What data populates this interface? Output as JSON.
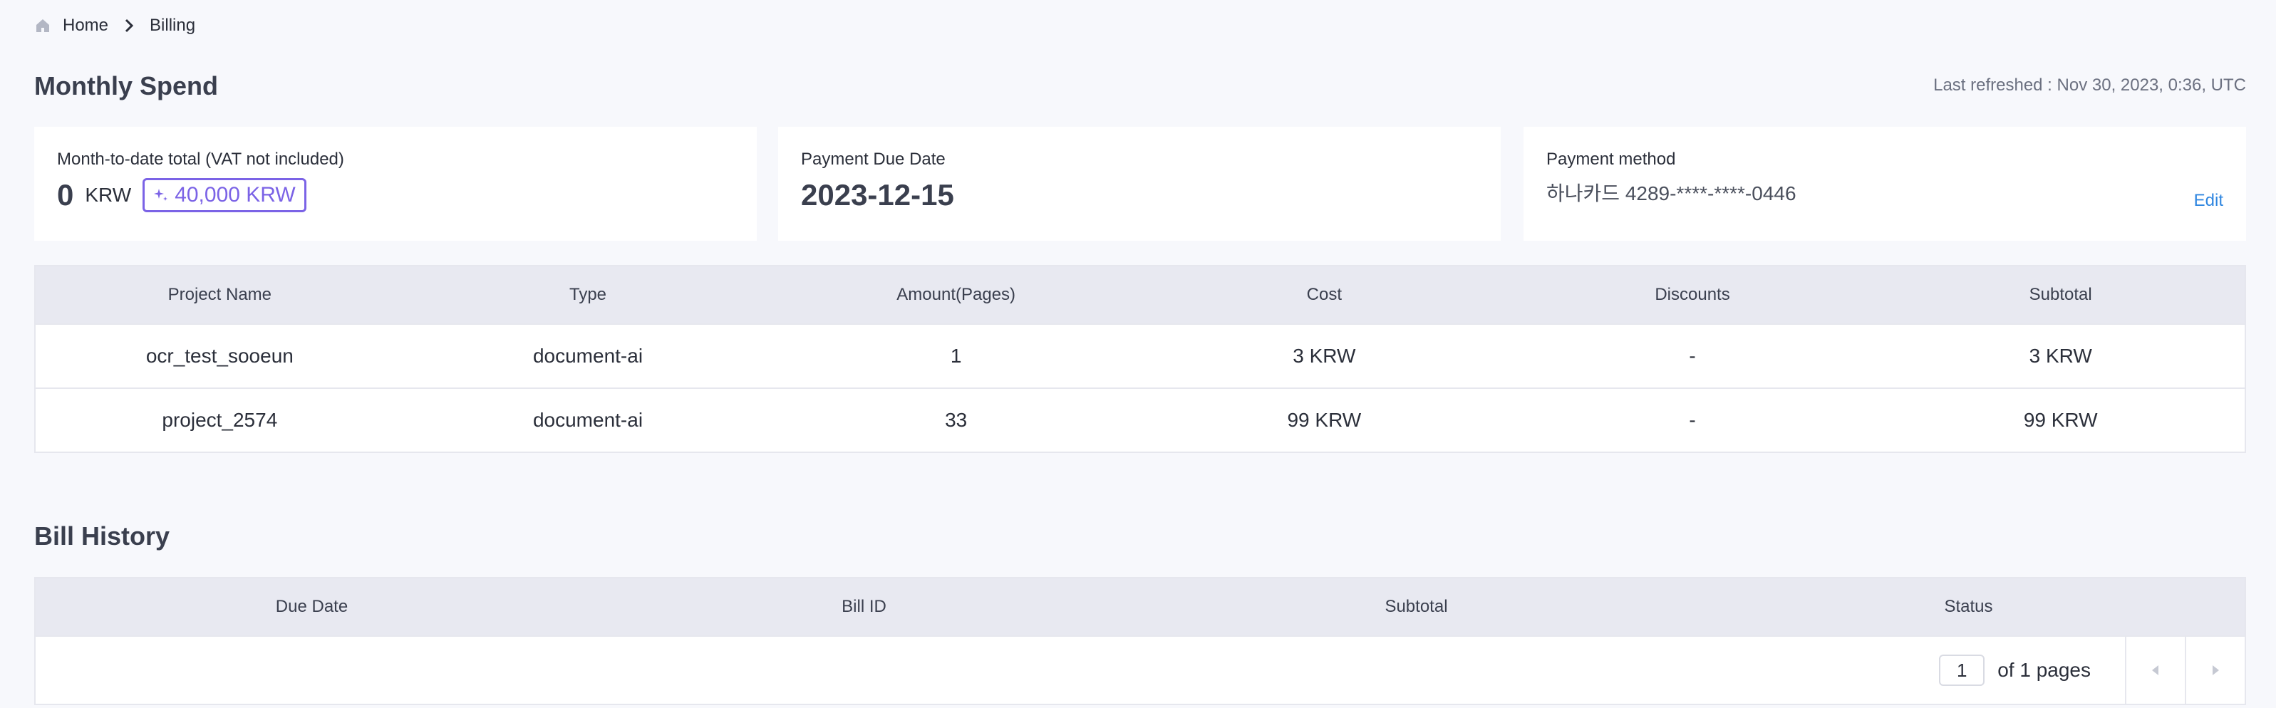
{
  "breadcrumb": {
    "home_label": "Home",
    "current_label": "Billing"
  },
  "monthly_spend": {
    "title": "Monthly Spend",
    "last_refreshed": "Last refreshed : Nov 30, 2023, 0:36, UTC"
  },
  "cards": {
    "mtd": {
      "label": "Month-to-date total (VAT not included)",
      "amount": "0",
      "unit": "KRW",
      "credit": "40,000 KRW"
    },
    "due": {
      "label": "Payment Due Date",
      "date": "2023-12-15"
    },
    "payment": {
      "label": "Payment method",
      "card": "하나카드 4289-****-****-0446",
      "edit_label": "Edit"
    }
  },
  "usage_table": {
    "headers": [
      "Project Name",
      "Type",
      "Amount(Pages)",
      "Cost",
      "Discounts",
      "Subtotal"
    ],
    "rows": [
      [
        "ocr_test_sooeun",
        "document-ai",
        "1",
        "3 KRW",
        "-",
        "3 KRW"
      ],
      [
        "project_2574",
        "document-ai",
        "33",
        "99 KRW",
        "-",
        "99 KRW"
      ]
    ]
  },
  "bill_history": {
    "title": "Bill History",
    "headers": [
      "Due Date",
      "Bill ID",
      "Subtotal",
      "Status"
    ],
    "pagination": {
      "page_value": "1",
      "of_text": "of 1 pages"
    }
  },
  "colors": {
    "accent": "#7b63e6",
    "link": "#2f86e0",
    "header_bg": "#e8e9f1",
    "page_bg": "#f7f8fc"
  },
  "icons": {
    "home": "home-icon",
    "separator": "chevron-right-icon",
    "credit": "sparkle-icon",
    "prev": "caret-left-icon",
    "next": "caret-right-icon"
  }
}
